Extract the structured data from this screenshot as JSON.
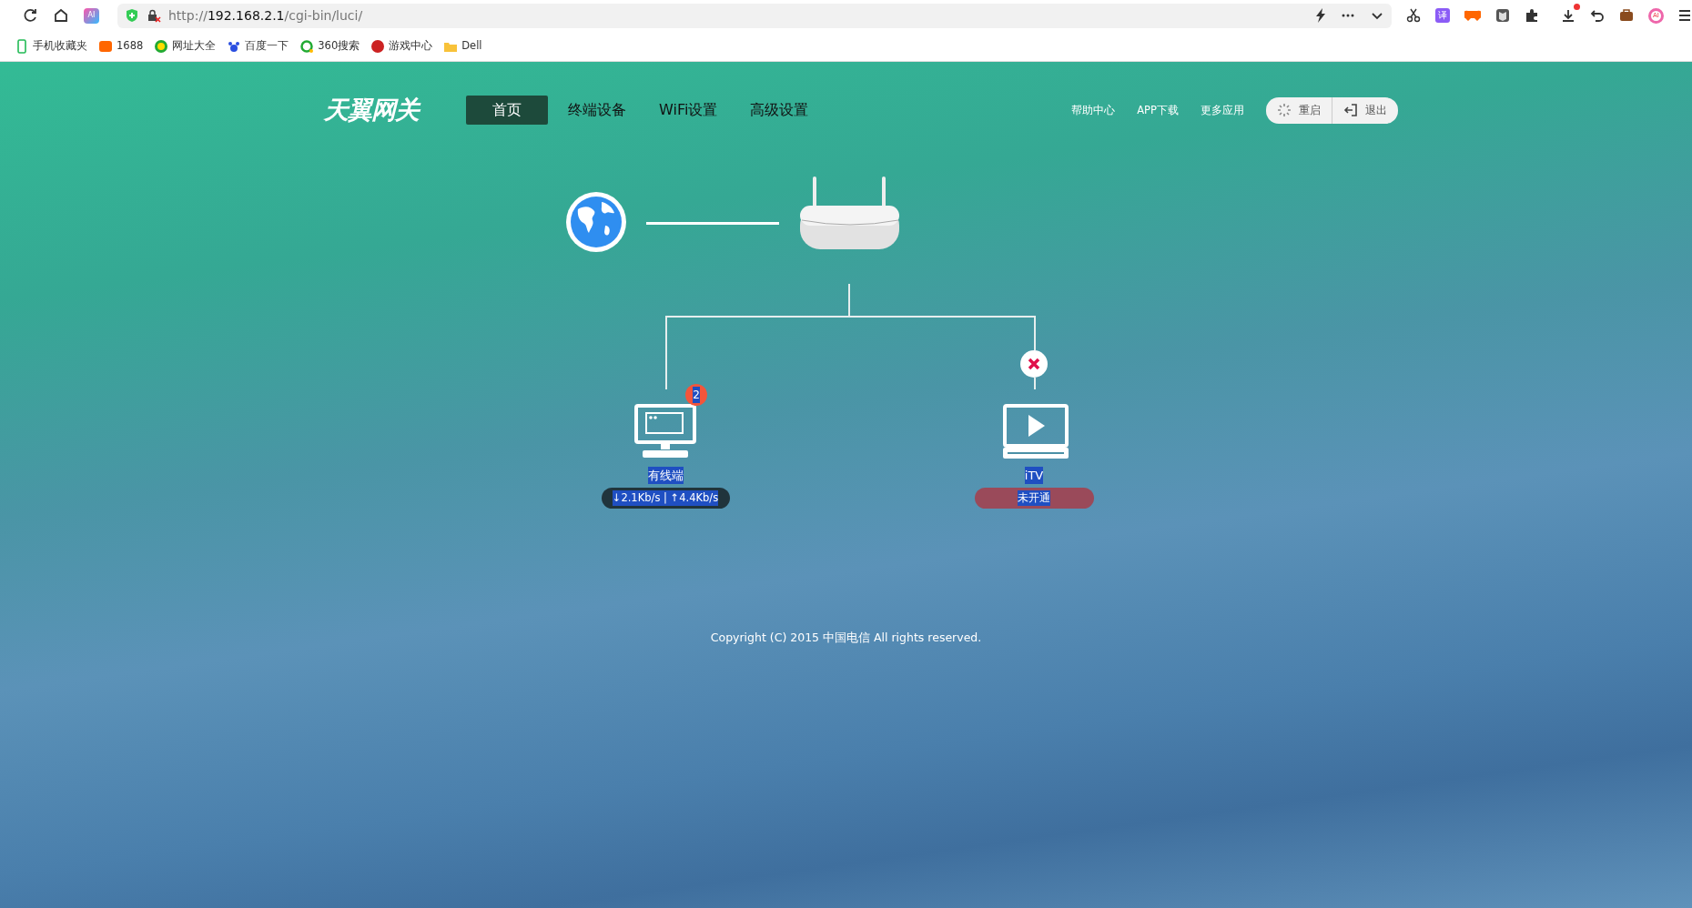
{
  "browser": {
    "ai_label": "AI",
    "url": [
      {
        "text": "http://",
        "emphasis": false
      },
      {
        "text": "192.168.2.1",
        "emphasis": true
      },
      {
        "text": "/cgi-bin/luci/",
        "emphasis": false
      }
    ],
    "translate_label": "译",
    "ai_ext_label": "AI",
    "download_alert": true,
    "bookmarks": [
      "手机收藏夹",
      "1688",
      "网址大全",
      "百度一下",
      "360搜索",
      "游戏中心",
      "Dell"
    ]
  },
  "header": {
    "logo": "天翼网关",
    "nav": [
      {
        "label": "首页",
        "selected": true
      },
      {
        "label": "终端设备",
        "selected": false
      },
      {
        "label": "WiFi设置",
        "selected": false
      },
      {
        "label": "高级设置",
        "selected": false
      }
    ],
    "links": [
      "帮助中心",
      "APP下载",
      "更多应用"
    ],
    "buttons": [
      {
        "label": "重启",
        "kind": "restart"
      },
      {
        "label": "退出",
        "kind": "logout"
      }
    ]
  },
  "devices": [
    {
      "kind": "computer",
      "label": "有线端",
      "badge": "2",
      "status": "↓2.1Kb/s | ↑4.4Kb/s",
      "connected": true,
      "text_selected": true
    },
    {
      "kind": "tv",
      "label": "iTV",
      "status": "未开通",
      "connected": false,
      "text_selected": true
    }
  ],
  "footer": "Copyright (C) 2015 中国电信 All rights reserved."
}
